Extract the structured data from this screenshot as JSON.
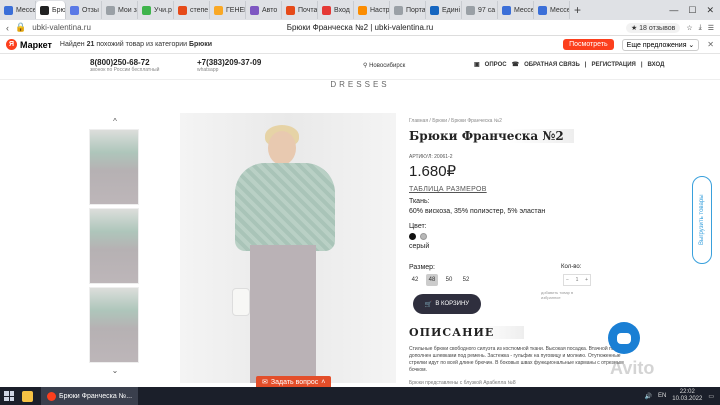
{
  "browser": {
    "tabs": [
      {
        "label": "Мессе",
        "color": "#3b6fd8"
      },
      {
        "label": "Брю",
        "color": "#222222",
        "active": true
      },
      {
        "label": "Отзы",
        "color": "#5a79e6"
      },
      {
        "label": "Мои з",
        "color": "#9aa0a6"
      },
      {
        "label": "Учи.р",
        "color": "#3fb44c"
      },
      {
        "label": "степе",
        "color": "#e64a19"
      },
      {
        "label": "ГЕНЕР",
        "color": "#f9a825"
      },
      {
        "label": "Авто",
        "color": "#7e57c2"
      },
      {
        "label": "Почта",
        "color": "#e64a19"
      },
      {
        "label": "Вход",
        "color": "#e53935"
      },
      {
        "label": "Настр",
        "color": "#fb8c00"
      },
      {
        "label": "Порта",
        "color": "#9aa0a6"
      },
      {
        "label": "Едині",
        "color": "#1565c0"
      },
      {
        "label": "97 са",
        "color": "#9aa0a6"
      },
      {
        "label": "Мессе",
        "color": "#3b6fd8"
      },
      {
        "label": "Мессе",
        "color": "#3b6fd8"
      }
    ],
    "new_tab": "+",
    "url": "ubki-valentina.ru",
    "page_title": "Брюки Франческа №2 | ubki-valentina.ru",
    "reviews_badge": "★ 18 отзывов"
  },
  "market_bar": {
    "logo": "Маркет",
    "message_prefix": "Найден ",
    "message_count": "21",
    "message_mid": " похожий товар из категории ",
    "message_category": "Брюки",
    "watch_button": "Посмотреть",
    "more_offers": "Еще предложения ⌄",
    "close": "✕"
  },
  "header": {
    "phone1": "8(800)250-68-72",
    "phone1_sub": "звонок по России бесплатный",
    "phone2": "+7(383)209-37-09",
    "phone2_sub": "whatsapp",
    "city": "Новосибирск",
    "links": [
      "ОПРОС",
      "ОБРАТНАЯ СВЯЗЬ",
      "РЕГИСТРАЦИЯ",
      "ВХОД"
    ]
  },
  "brand": "DRESSES",
  "gallery": {
    "up": "^",
    "down": "⌄"
  },
  "ask_question": "Задать вопрос",
  "product": {
    "breadcrumbs": "Главная  /  Брюки  /  Брюки Франческа №2",
    "title": "Брюки Франческа №2",
    "article": "АРТИКУЛ: 20061-2",
    "price": "1.680₽",
    "size_table": "ТАБЛИЦА РАЗМЕРОВ",
    "fabric_label": "Ткань:",
    "fabric": "60% вискоза, 35% полиэстер, 5% эластан",
    "color_label": "Цвет:",
    "colors": [
      "#111111",
      "#b8b8b8"
    ],
    "color_name": "серый",
    "size_label": "Размер:",
    "sizes": [
      "42",
      "48",
      "50",
      "52"
    ],
    "selected_size": "48",
    "qty_label": "Кол-во:",
    "qty_value": "1",
    "qty_hint": "добавить товар в избранное",
    "cart_button": "В КОРЗИНУ",
    "desc_heading": "ОПИСАНИЕ",
    "description": "Стильные брюки свободного силуэта из костюмной ткани. Высокая посадка. Втачной пояс, дополнен шлевками под ремень. Застежка - гульфик на пуговицу и молнию. Отутюженные стрелки идут по всей длине брючин. В боковых швах функциональные карманы с отрезным бочком.",
    "description2": "Брюки представлены с блузкой Арабелла №8"
  },
  "widgets": {
    "export_label": "Выгрузить товары",
    "watermark": "Avito"
  },
  "taskbar": {
    "app_label": "Брюки Франческа №...",
    "lang": "EN",
    "time": "22:02",
    "date": "10.03.2022"
  }
}
